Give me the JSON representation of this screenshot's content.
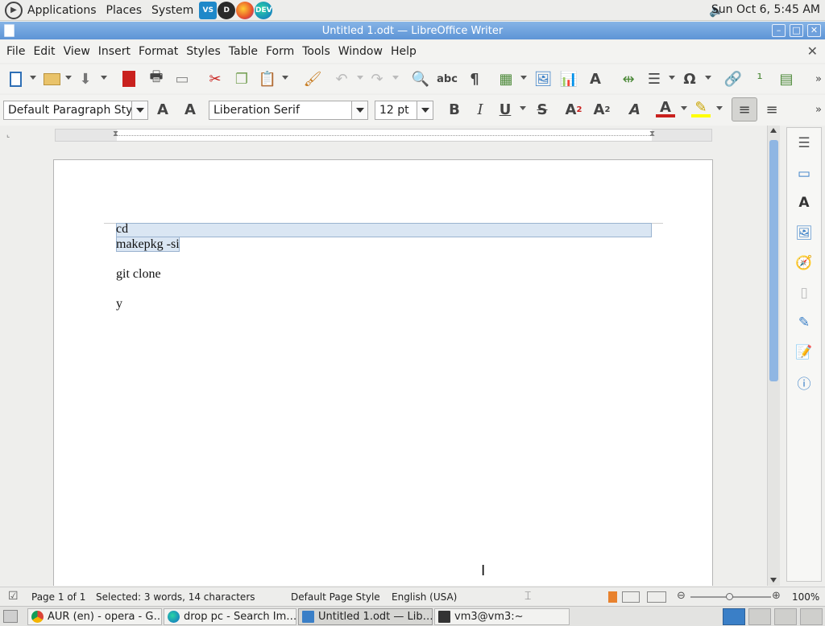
{
  "top_panel": {
    "menus": [
      "Applications",
      "Places",
      "System"
    ],
    "launchers": [
      "vscode-icon",
      "deepin-icon",
      "firefox-icon",
      "edge-dev-icon"
    ],
    "clock": "Sun Oct  6,  5:45 AM"
  },
  "window": {
    "title": "Untitled 1.odt — LibreOffice Writer"
  },
  "menubar": [
    "File",
    "Edit",
    "View",
    "Insert",
    "Format",
    "Styles",
    "Table",
    "Form",
    "Tools",
    "Window",
    "Help"
  ],
  "format_toolbar": {
    "paragraph_style": "Default Paragraph Style",
    "font_name": "Liberation Serif",
    "font_size": "12 pt"
  },
  "document": {
    "lines": [
      "cd",
      "makepkg -si",
      "git clone",
      "y"
    ]
  },
  "statusbar": {
    "page": "Page 1 of 1",
    "selection": "Selected: 3 words, 14 characters",
    "page_style": "Default Page Style",
    "language": "English (USA)",
    "zoom": "100%"
  },
  "taskbar": {
    "tasks": [
      "AUR (en) - opera - G…",
      "drop pc - Search Im…",
      "Untitled 1.odt — Lib…",
      "vm3@vm3:~"
    ]
  },
  "colors": {
    "titlebar": "#5d94d6",
    "selection": "#dae6f3",
    "font_color_bar": "#c9211e",
    "highlight_bar": "#ffff00"
  }
}
